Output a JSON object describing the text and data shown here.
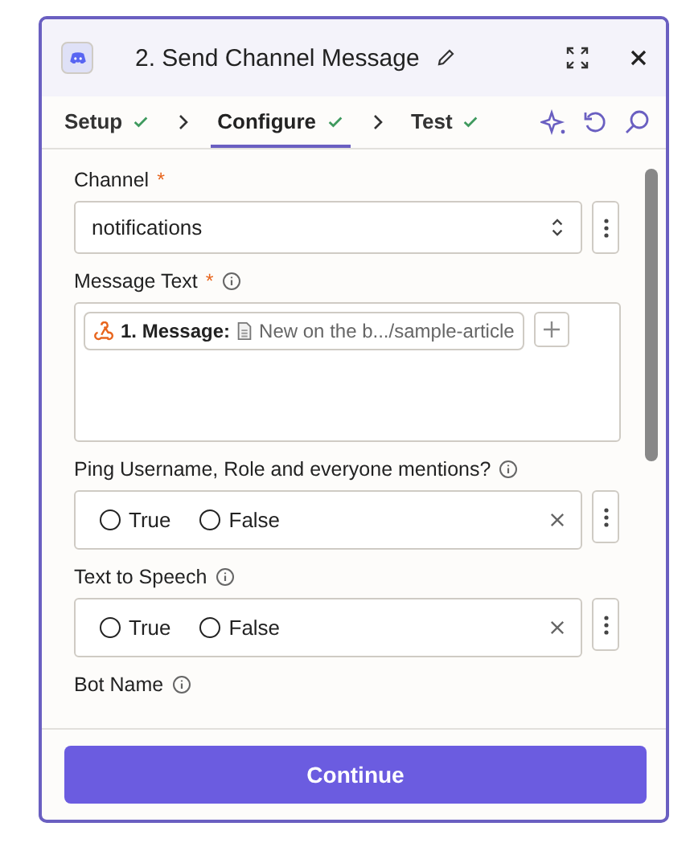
{
  "header": {
    "title": "2. Send Channel Message"
  },
  "steps": [
    {
      "label": "Setup",
      "done": true,
      "selected": false
    },
    {
      "label": "Configure",
      "done": true,
      "selected": true
    },
    {
      "label": "Test",
      "done": true,
      "selected": false
    }
  ],
  "fields": [
    {
      "kind": "select",
      "label": "Channel",
      "required_mark": "*",
      "info": false,
      "value": "notifications"
    },
    {
      "kind": "tokens",
      "label": "Message Text",
      "required_mark": "*",
      "info": true,
      "token": {
        "step": "1. Message:",
        "value": "New on the b.../sample-article"
      }
    },
    {
      "kind": "radio",
      "label": "Ping Username, Role and everyone mentions?",
      "info": true,
      "options": [
        {
          "label": "True",
          "selected": false
        },
        {
          "label": "False",
          "selected": false
        }
      ]
    },
    {
      "kind": "radio",
      "label": "Text to Speech",
      "info": true,
      "options": [
        {
          "label": "True",
          "selected": false
        },
        {
          "label": "False",
          "selected": false
        }
      ]
    },
    {
      "kind": "label",
      "label": "Bot Name",
      "info": true
    }
  ],
  "continue_button": "Continue"
}
